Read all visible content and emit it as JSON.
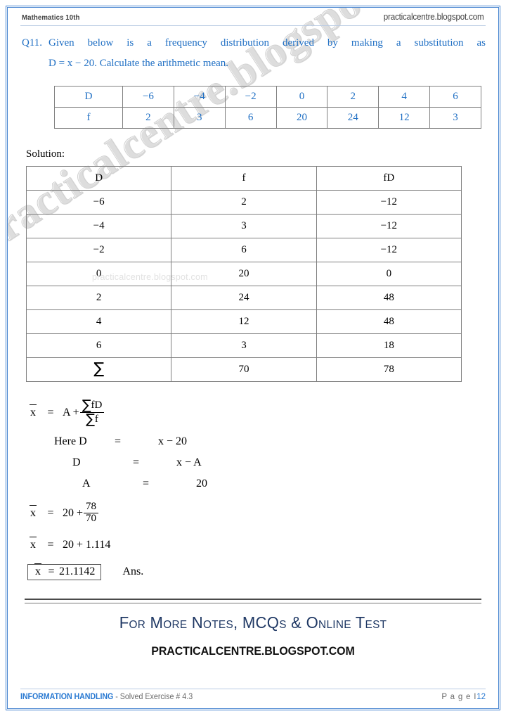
{
  "header": {
    "subject": "Mathematics 10th",
    "site": "practicalcentre.blogspot.com"
  },
  "watermark": {
    "diagonal": "practicalcentre.blogspot.com",
    "inline": "practicalcentre.blogspot.com"
  },
  "question": {
    "number": "Q11.",
    "line1": "Given below is a frequency distribution derived by making a substitution as",
    "line2": "D = x − 20. Calculate the arithmetic mean."
  },
  "freq_table": {
    "rows": [
      {
        "label": "D",
        "values": [
          "−6",
          "−4",
          "−2",
          "0",
          "2",
          "4",
          "6"
        ]
      },
      {
        "label": "f",
        "values": [
          "2",
          "3",
          "6",
          "20",
          "24",
          "12",
          "3"
        ]
      }
    ]
  },
  "solution": {
    "label": "Solution:",
    "table": {
      "headers": [
        "D",
        "f",
        "fD"
      ],
      "rows": [
        [
          "−6",
          "2",
          "−12"
        ],
        [
          "−4",
          "3",
          "−12"
        ],
        [
          "−2",
          "6",
          "−12"
        ],
        [
          "0",
          "20",
          "0"
        ],
        [
          "2",
          "24",
          "48"
        ],
        [
          "4",
          "12",
          "48"
        ],
        [
          "6",
          "3",
          "18"
        ]
      ],
      "total_row": [
        "∑",
        "70",
        "78"
      ]
    }
  },
  "working": {
    "formula": {
      "lhs": "x",
      "eq": "=",
      "a_term": "A +",
      "numerator": "fD",
      "denominator": "f",
      "sigma": "∑"
    },
    "defs": [
      {
        "label": "Here  D",
        "eq": "=",
        "value": "x − 20"
      },
      {
        "label": "D",
        "eq": "=",
        "value": "x − A"
      },
      {
        "label": "A",
        "eq": "=",
        "value": "20"
      }
    ],
    "step_fraction": {
      "lhs": "x",
      "eq": "=",
      "base": "20 +",
      "numerator": "78",
      "denominator": "70"
    },
    "step_decimal": {
      "lhs": "x",
      "eq": "=",
      "value": "20 + 1.114"
    },
    "answer": {
      "lhs": "x",
      "eq": "=",
      "value": "21.1142",
      "suffix": "Ans."
    }
  },
  "promo": {
    "title": "For More Notes, MCQs & Online Test",
    "url": "PRACTICALCENTRE.BLOGSPOT.COM"
  },
  "footer": {
    "chapter": "INFORMATION HANDLING",
    "exercise": " - Solved Exercise # 4.3",
    "page_label": "P a g e I",
    "page_number": "12"
  },
  "colors": {
    "accent_blue": "#1f6fc4",
    "border_blue": "#4a86d0",
    "promo_navy": "#1f3864",
    "rule_gray": "#808080"
  }
}
